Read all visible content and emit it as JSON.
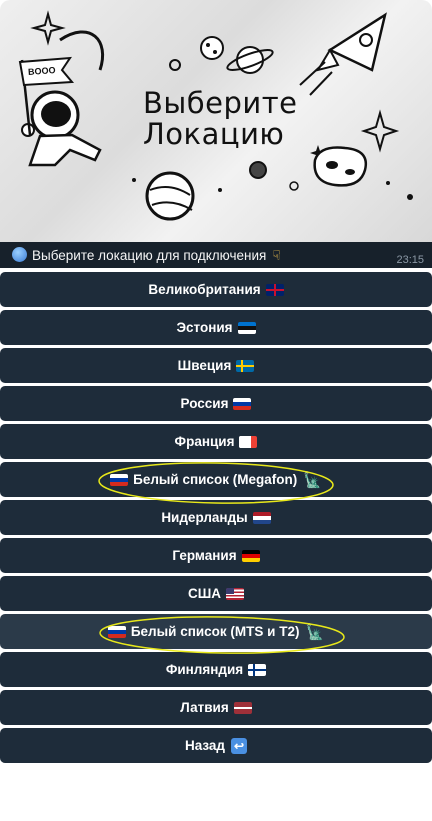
{
  "banner": {
    "title_line1": "Выберите",
    "title_line2": "Локацию",
    "flag_text": "BOOO"
  },
  "message": {
    "text": "Выберите локацию для подключения",
    "time": "23:15",
    "globe_icon": "globe-icon",
    "pointing_icon": "pointing-down-hand-icon"
  },
  "buttons": [
    {
      "label": "Великобритания",
      "flag": "gb"
    },
    {
      "label": "Эстония",
      "flag": "ee"
    },
    {
      "label": "Швеция",
      "flag": "se"
    },
    {
      "label": "Россия",
      "flag": "ru"
    },
    {
      "label": "Франция",
      "flag": "fr"
    },
    {
      "label": "Белый список (Megafon)",
      "flag": "ru",
      "flag_position": "before",
      "suffix_icon": "statue-of-liberty-icon",
      "circled": true
    },
    {
      "label": "Нидерланды",
      "flag": "nl"
    },
    {
      "label": "Германия",
      "flag": "de"
    },
    {
      "label": "США",
      "flag": "us"
    },
    {
      "label": "Белый список (MTS и T2)",
      "flag": "ru",
      "flag_position": "before",
      "suffix_icon": "statue-of-liberty-icon",
      "circled": true,
      "active": true
    },
    {
      "label": "Финляндия",
      "flag": "fi"
    },
    {
      "label": "Латвия",
      "flag": "lv"
    },
    {
      "label": "Назад",
      "suffix_icon": "back-arrow-icon"
    }
  ],
  "colors": {
    "button_bg": "#1e2c3a",
    "button_active_bg": "#2b3a49",
    "caption_bg": "#17212b",
    "highlight": "#e8e81a"
  }
}
